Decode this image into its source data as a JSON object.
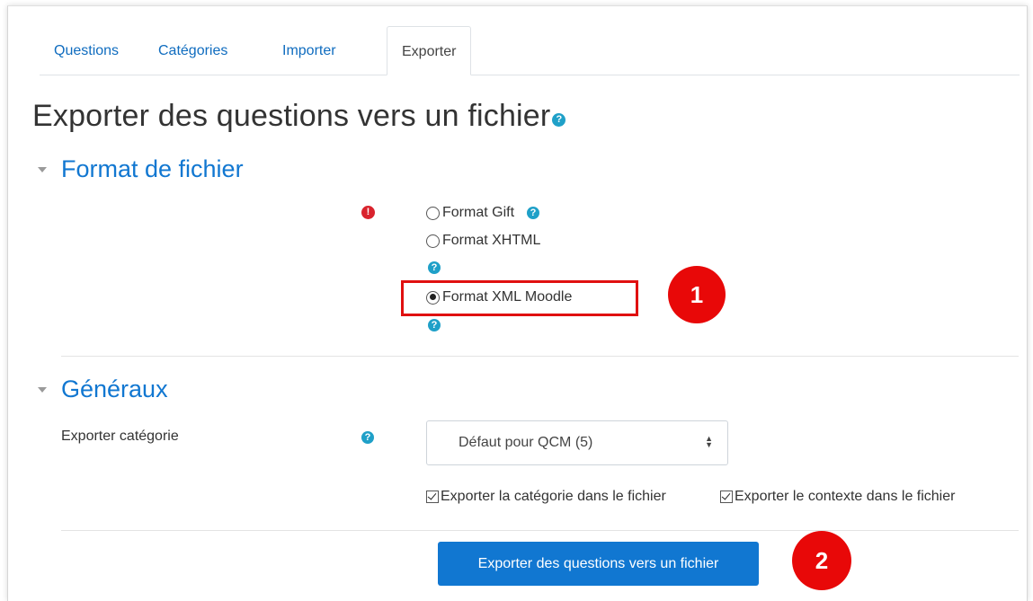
{
  "tabs": [
    {
      "label": "Questions",
      "active": false
    },
    {
      "label": "Catégories",
      "active": false
    },
    {
      "label": "Importer",
      "active": false
    },
    {
      "label": "Exporter",
      "active": true
    }
  ],
  "page_title": "Exporter des questions vers un fichier",
  "sections": {
    "format": {
      "legend": "Format de fichier",
      "options": [
        {
          "label": "Format Gift",
          "selected": false
        },
        {
          "label": "Format XHTML",
          "selected": false
        },
        {
          "label": "Format XML Moodle",
          "selected": true
        }
      ]
    },
    "general": {
      "legend": "Généraux",
      "category_label": "Exporter catégorie",
      "category_value": "Défaut pour QCM (5)",
      "checkbox_category": {
        "label": "Exporter la catégorie dans le fichier",
        "checked": true
      },
      "checkbox_context": {
        "label": "Exporter le contexte dans le fichier",
        "checked": true
      }
    }
  },
  "submit_label": "Exporter des questions vers un fichier",
  "annotations": {
    "badge_1": "1",
    "badge_2": "2"
  },
  "icons": {
    "help": "question-circle-icon",
    "required": "exclamation-circle-icon",
    "collapse": "caret-down-icon"
  },
  "colors": {
    "link": "#0f6cbf",
    "heading": "#1177d1",
    "button": "#1177d1",
    "help": "#1fa0c8",
    "annotation": "#e80808"
  }
}
